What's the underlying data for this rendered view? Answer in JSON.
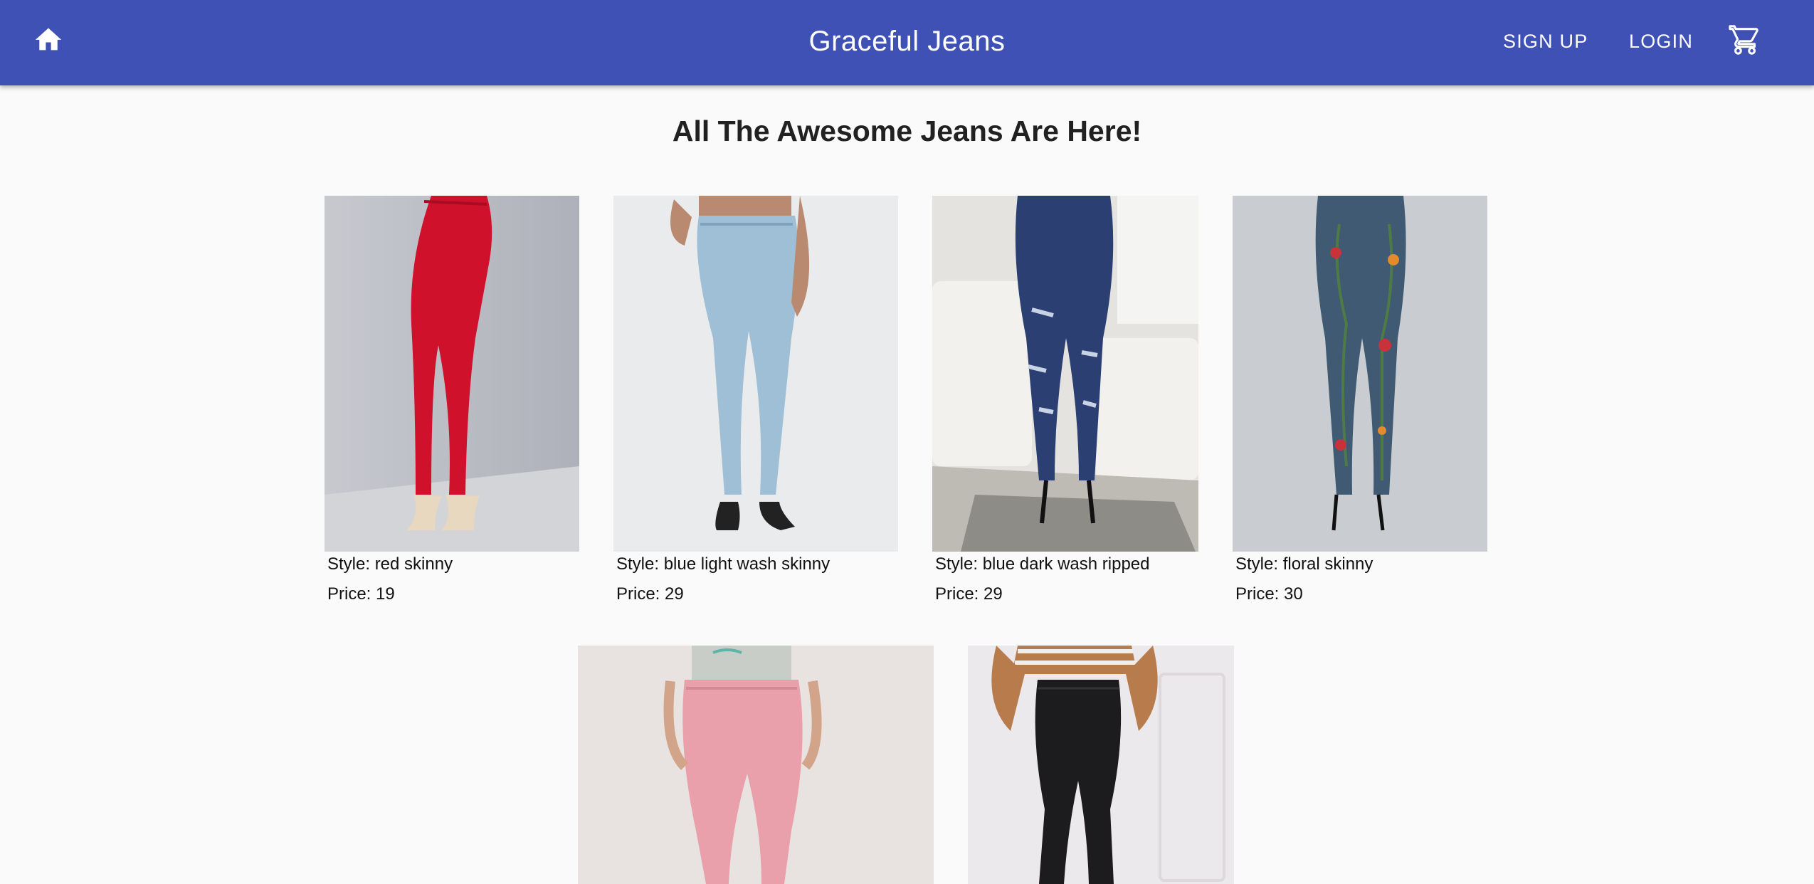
{
  "app": {
    "title": "Graceful Jeans",
    "colors": {
      "primary": "#3f51b5",
      "background": "#fafafa"
    }
  },
  "toolbar": {
    "home_icon": "home-icon",
    "signup_label": "SIGN UP",
    "login_label": "LOGIN",
    "cart_icon": "shopping-cart-icon"
  },
  "main": {
    "heading": "All The Awesome Jeans Are Here!",
    "products": [
      {
        "style": "Style: red skinny",
        "price": "Price: 19",
        "photo_alt": "red skinny jeans"
      },
      {
        "style": "Style: blue light wash skinny",
        "price": "Price: 29",
        "photo_alt": "blue light wash skinny jeans"
      },
      {
        "style": "Style: blue dark wash ripped",
        "price": "Price: 29",
        "photo_alt": "blue dark wash ripped jeans"
      },
      {
        "style": "Style: floral skinny",
        "price": "Price: 30",
        "photo_alt": "floral skinny jeans"
      },
      {
        "style": "",
        "price": "",
        "photo_alt": "pink jeans"
      },
      {
        "style": "",
        "price": "",
        "photo_alt": "black flare jeans"
      }
    ]
  }
}
